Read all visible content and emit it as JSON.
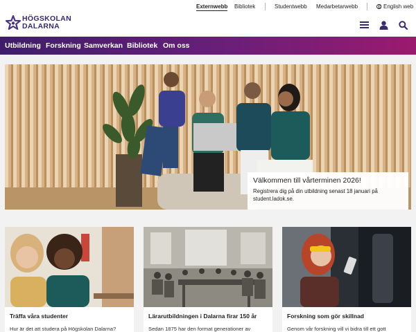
{
  "utility": {
    "externwebb": "Externwebb",
    "bibliotek": "Bibliotek",
    "studentwebb": "Studentwebb",
    "medarbetarwebb": "Medarbetarwebb",
    "language": "English web"
  },
  "logo": {
    "text": "HÖGSKOLAN\nDALARNA"
  },
  "header_icons": [
    "menu-icon",
    "user-icon",
    "search-icon"
  ],
  "nav": [
    "Utbildning",
    "Forskning",
    "Samverkan",
    "Bibliotek",
    "Om oss"
  ],
  "hero": {
    "title": "Välkommen till vårterminen 2026!",
    "text_line1": "Registrera dig på din utbildning senast 18 januari på",
    "text_line2": "student.ladok.se."
  },
  "cards": [
    {
      "title": "Träffa våra studenter",
      "text": "Hur är det att studera på Högskolan Dalarna?"
    },
    {
      "title": "Lärarutbildningen i Dalarna firar 150 år",
      "text": "Sedan 1875 har den format generationer av"
    },
    {
      "title": "Forskning som gör skillnad",
      "text": "Genom vår forskning vill vi bidra till ett gott"
    }
  ],
  "colors": {
    "nav_start": "#3f1d6b",
    "nav_end": "#9b1a6e",
    "logo": "#3b2a6b"
  }
}
